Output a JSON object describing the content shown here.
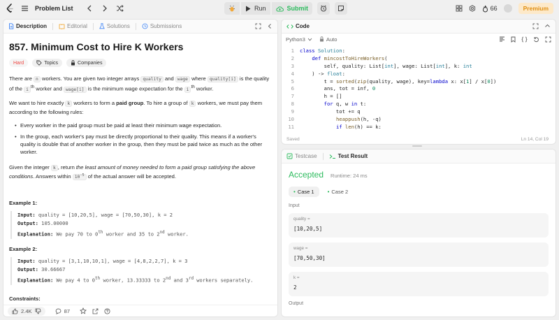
{
  "topbar": {
    "problem_list": "Problem List",
    "run": "Run",
    "submit": "Submit",
    "streak": "66",
    "premium": "Premium"
  },
  "description_panel": {
    "tabs": [
      "Description",
      "Editorial",
      "Solutions",
      "Submissions"
    ],
    "title": "857. Minimum Cost to Hire K Workers",
    "difficulty": "Hard",
    "tags": [
      "Topics",
      "Companies"
    ],
    "p1": {
      "a": "There are ",
      "n": "n",
      "b": " workers. You are given two integer arrays ",
      "quality": "quality",
      "c": " and ",
      "wage": "wage",
      "d": " where ",
      "quality_i": "quality[i]",
      "e": " is the quality of the ",
      "ith": "i",
      "th": "th",
      "f": " worker and ",
      "wage_i": "wage[i]",
      "g": " is the minimum wage expectation for the ",
      "ith2": "i",
      "th2": "th",
      "h": " worker."
    },
    "p2": {
      "a": "We want to hire exactly ",
      "k": "k",
      "b": " workers to form a ",
      "paid_group": "paid group",
      "c": ". To hire a group of ",
      "k2": "k",
      "d": " workers, we must pay them according to the following rules:"
    },
    "rules": [
      "Every worker in the paid group must be paid at least their minimum wage expectation.",
      "In the group, each worker's pay must be directly proportional to their quality. This means if a worker's quality is double that of another worker in the group, then they must be paid twice as much as the other worker."
    ],
    "p3": {
      "a": "Given the integer ",
      "k": "k",
      "b": ", return ",
      "emph": "the least amount of money needed to form a paid group satisfying the above conditions",
      "c": ". Answers within ",
      "tol": "10",
      "tol_exp": "-5",
      "d": " of the actual answer will be accepted."
    },
    "examples": [
      {
        "title": "Example 1:",
        "input_label": "Input:",
        "input": " quality = [10,20,5], wage = [70,50,30], k = 2",
        "output_label": "Output:",
        "output": " 105.00000",
        "expl_label": "Explanation:",
        "expl_a": " We pay 70 to 0",
        "sup1": "th",
        "expl_b": " worker and 35 to 2",
        "sup2": "nd",
        "expl_c": " worker."
      },
      {
        "title": "Example 2:",
        "input_label": "Input:",
        "input": " quality = [3,1,10,10,1], wage = [4,8,2,2,7], k = 3",
        "output_label": "Output:",
        "output": " 30.66667",
        "expl_label": "Explanation:",
        "expl_a": " We pay 4 to 0",
        "sup1": "th",
        "expl_b": " worker, 13.33333 to 2",
        "sup2": "nd",
        "expl_c": " and 3",
        "sup3": "rd",
        "expl_d": " workers separately."
      }
    ],
    "constraints": "Constraints:",
    "footer": {
      "likes": "2.4K",
      "comments": "87"
    }
  },
  "code_panel": {
    "tab": "Code",
    "language": "Python3",
    "auto": "Auto",
    "lines": [
      {
        "n": "1"
      },
      {
        "n": "2"
      },
      {
        "n": "3"
      },
      {
        "n": "4"
      },
      {
        "n": "5"
      },
      {
        "n": "6"
      },
      {
        "n": "7"
      },
      {
        "n": "8"
      },
      {
        "n": "9"
      },
      {
        "n": "10"
      },
      {
        "n": "11"
      }
    ],
    "status_left": "Saved",
    "status_right": "Ln 14, Col 19"
  },
  "test_panel": {
    "tabs": [
      "Testcase",
      "Test Result"
    ],
    "accepted": "Accepted",
    "runtime": "Runtime: 24 ms",
    "cases": [
      "Case 1",
      "Case 2"
    ],
    "input_label": "Input",
    "inputs": [
      {
        "name": "quality =",
        "value": "[10,20,5]"
      },
      {
        "name": "wage =",
        "value": "[70,50,30]"
      },
      {
        "name": "k =",
        "value": "2"
      }
    ],
    "output_label": "Output"
  },
  "colors": {
    "accepted_green": "#2cbb5d",
    "hard_red": "#ef4743",
    "premium_orange": "#e08f12"
  }
}
